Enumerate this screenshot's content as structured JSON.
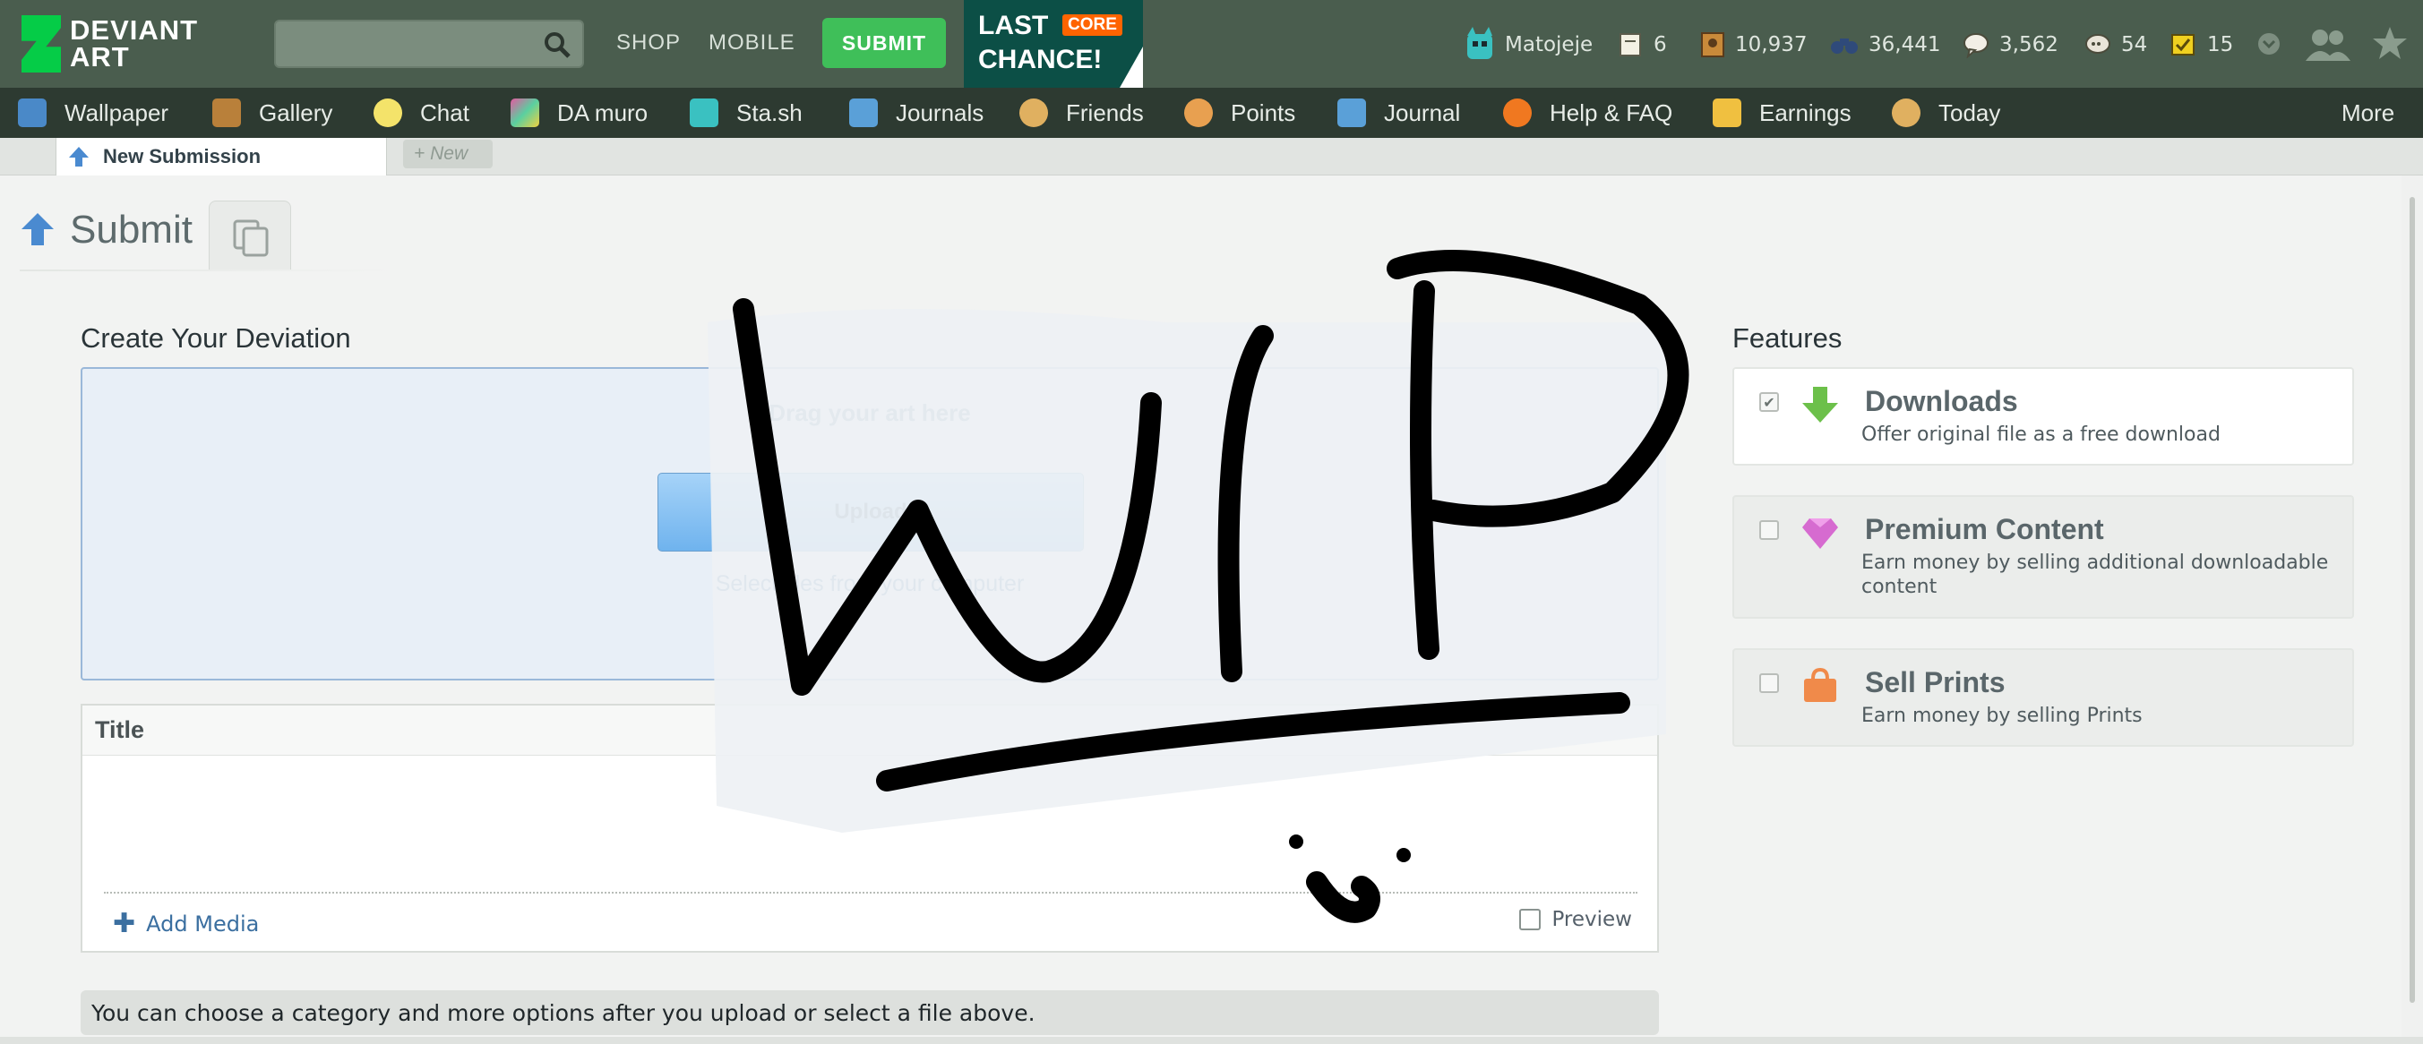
{
  "header": {
    "logo_line1": "DEVIANT",
    "logo_line2": "ART",
    "search_placeholder": "",
    "links": [
      "SHOP",
      "MOBILE"
    ],
    "submit_label": "SUBMIT",
    "promo": {
      "line1": "LAST",
      "badge": "CORE",
      "line2": "CHANCE!"
    },
    "username": "Matojeje",
    "stats": [
      {
        "icon": "notes-icon",
        "value": "6"
      },
      {
        "icon": "deviations-icon",
        "value": "10,937"
      },
      {
        "icon": "watch-icon",
        "value": "36,441"
      },
      {
        "icon": "comments-icon",
        "value": "3,562"
      },
      {
        "icon": "replies-icon",
        "value": "54"
      },
      {
        "icon": "activity-icon",
        "value": "15"
      }
    ]
  },
  "secondary_nav": {
    "items": [
      {
        "label": "Wallpaper",
        "icon": "wallpaper-icon",
        "color": "#4a89c8"
      },
      {
        "label": "Gallery",
        "icon": "gallery-icon",
        "color": "#b9803a"
      },
      {
        "label": "Chat",
        "icon": "chat-icon",
        "color": "#f4e36a"
      },
      {
        "label": "DA muro",
        "icon": "muro-icon",
        "color": "#e35aa0"
      },
      {
        "label": "Sta.sh",
        "icon": "stash-icon",
        "color": "#3ac1c1"
      },
      {
        "label": "Journals",
        "icon": "journals-icon",
        "color": "#5aa0d8"
      },
      {
        "label": "Friends",
        "icon": "friends-icon",
        "color": "#e0b060"
      },
      {
        "label": "Points",
        "icon": "points-icon",
        "color": "#e8a050"
      },
      {
        "label": "Journal",
        "icon": "journal-icon",
        "color": "#5aa0d8"
      },
      {
        "label": "Help & FAQ",
        "icon": "help-icon",
        "color": "#f07820"
      },
      {
        "label": "Earnings",
        "icon": "earnings-icon",
        "color": "#f0c040"
      },
      {
        "label": "Today",
        "icon": "today-icon",
        "color": "#e0b060"
      }
    ],
    "more_label": "More"
  },
  "tabs": {
    "active_label": "New Submission",
    "new_label": "+ New"
  },
  "page": {
    "title": "Submit"
  },
  "create": {
    "heading": "Create Your Deviation",
    "drop_hint": "Drag your art here",
    "upload_label": "Upload",
    "select_link": "Select files from your computer",
    "title_label": "Title",
    "add_media": "Add Media",
    "preview": "Preview",
    "info": "You can choose a category and more options after you upload or select a file above."
  },
  "features": {
    "heading": "Features",
    "items": [
      {
        "name": "Downloads",
        "desc": "Offer original file as a free download",
        "checked": true,
        "icon": "download-arrow-icon",
        "color": "#6cc04a"
      },
      {
        "name": "Premium Content",
        "desc": "Earn money by selling additional downloadable content",
        "checked": false,
        "icon": "gem-icon",
        "color": "#d66bd0"
      },
      {
        "name": "Sell Prints",
        "desc": "Earn money by selling Prints",
        "checked": false,
        "icon": "bag-icon",
        "color": "#f08a4a"
      }
    ]
  },
  "overlay": {
    "drawing": "WIP"
  }
}
